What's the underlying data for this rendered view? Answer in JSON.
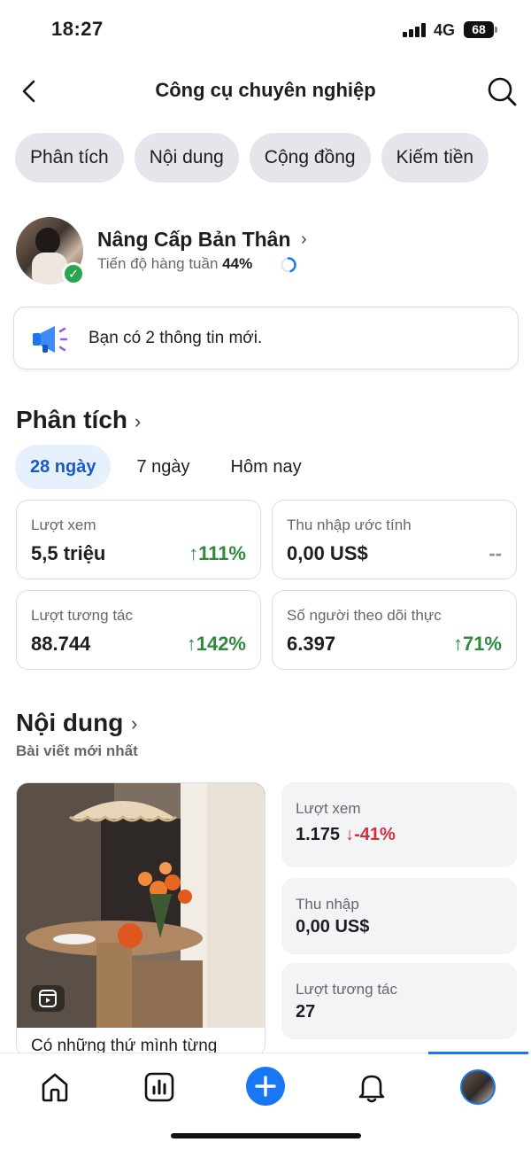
{
  "status_bar": {
    "time": "18:27",
    "network": "4G",
    "battery": "68"
  },
  "header": {
    "title": "Công cụ chuyên nghiệp"
  },
  "tabs": [
    {
      "label": "Phân tích"
    },
    {
      "label": "Nội dung"
    },
    {
      "label": "Cộng đồng"
    },
    {
      "label": "Kiếm tiền"
    }
  ],
  "profile": {
    "name": "Nâng Cấp Bản Thân",
    "progress_label": "Tiến độ hàng tuần",
    "progress_value": "44%",
    "progress_fraction": 0.44
  },
  "notice": {
    "text": "Bạn có 2 thông tin mới."
  },
  "analytics": {
    "title": "Phân tích",
    "ranges": [
      {
        "label": "28 ngày"
      },
      {
        "label": "7 ngày"
      },
      {
        "label": "Hôm nay"
      }
    ],
    "stats": [
      {
        "label": "Lượt xem",
        "value": "5,5 triệu",
        "change": "111%"
      },
      {
        "label": "Thu nhập ước tính",
        "value": "0,00 US$",
        "change": "--"
      },
      {
        "label": "Lượt tương tác",
        "value": "88.744",
        "change": "142%"
      },
      {
        "label": "Số người theo dõi thực",
        "value": "6.397",
        "change": "71%"
      }
    ]
  },
  "content": {
    "title": "Nội dung",
    "subtitle": "Bài viết mới nhất",
    "post_caption": "Có những thứ mình từng",
    "metrics": [
      {
        "label": "Lượt xem",
        "value": "1.175",
        "change": "-41%"
      },
      {
        "label": "Thu nhập",
        "value": "0,00 US$"
      },
      {
        "label": "Lượt tương tác",
        "value": "27"
      }
    ]
  },
  "colors": {
    "accent": "#1877f2",
    "positive": "#2f8a3e",
    "negative": "#d0303c"
  }
}
